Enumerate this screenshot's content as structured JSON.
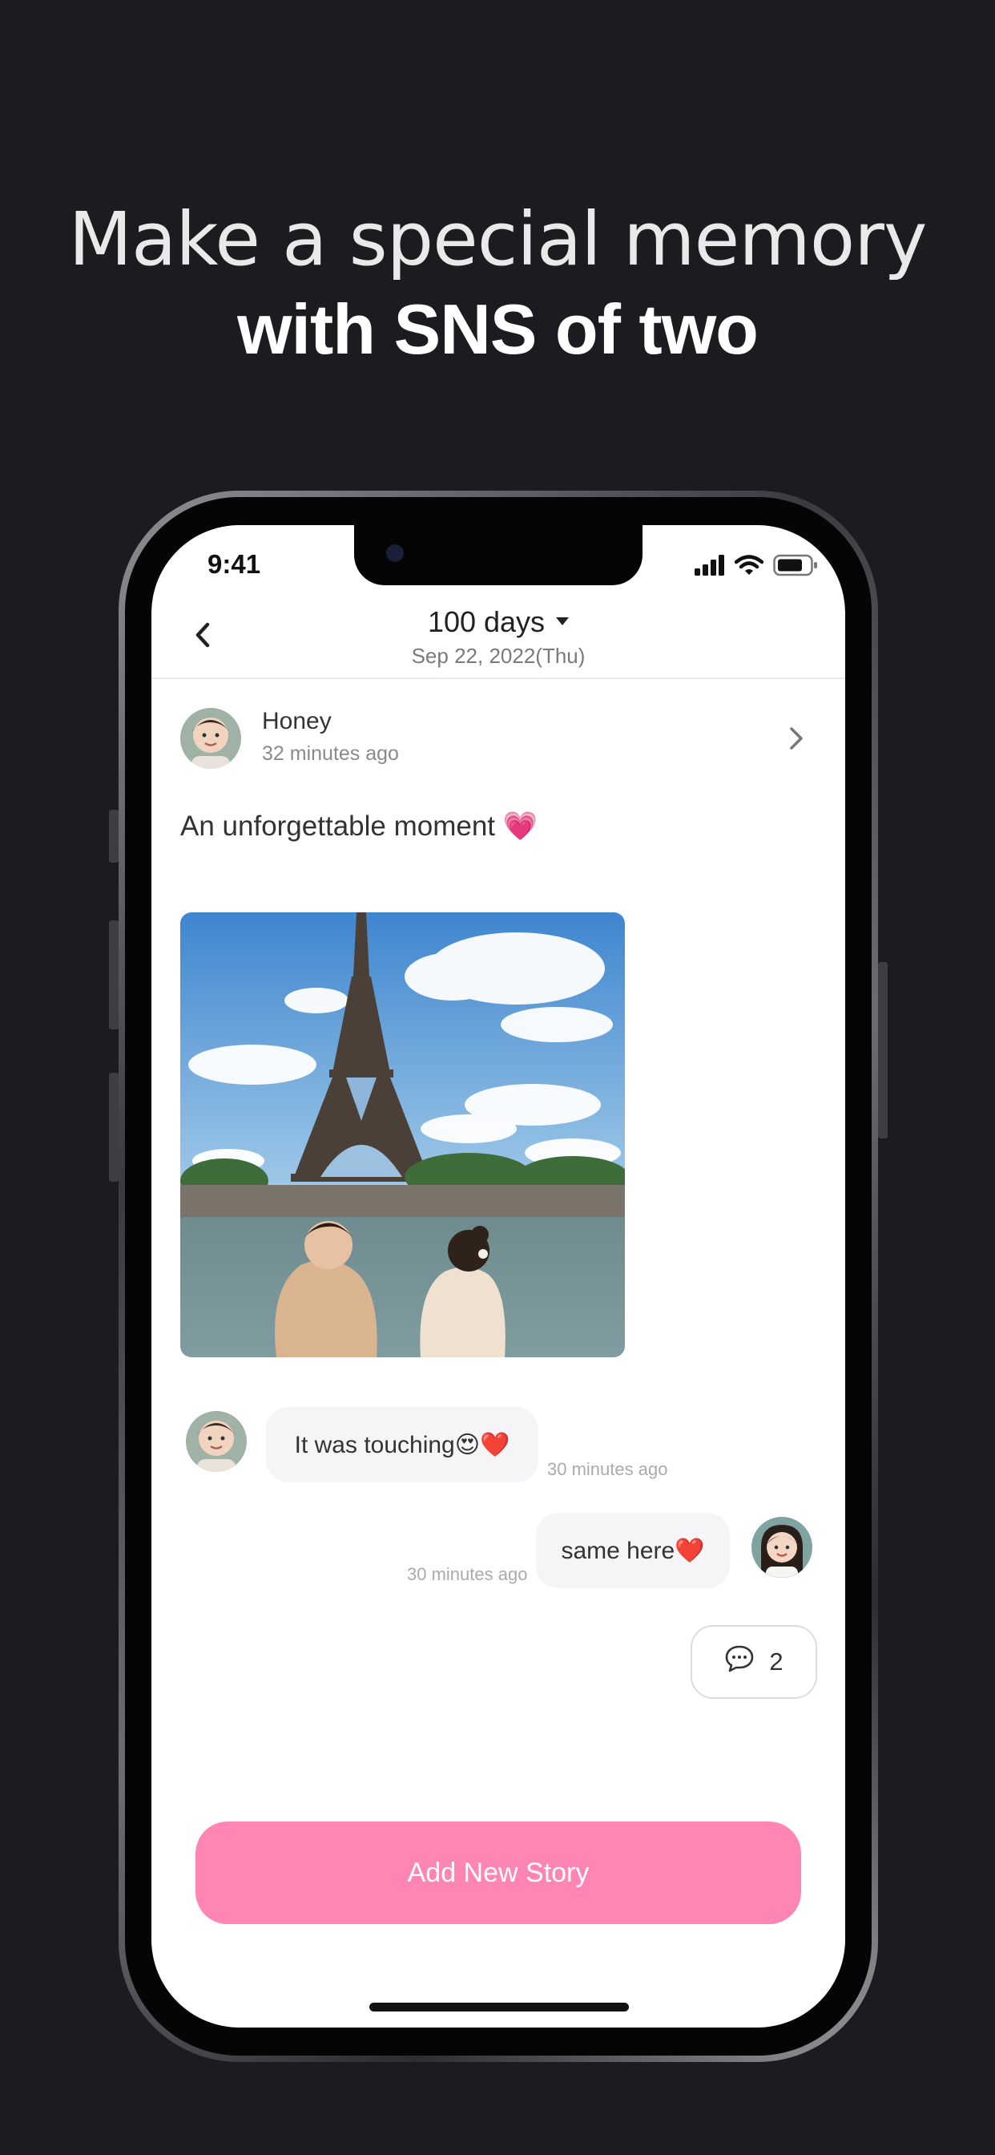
{
  "headline": {
    "line1": "Make a special memory",
    "line2": "with SNS of two"
  },
  "status_bar": {
    "time": "9:41",
    "icons": [
      "signal-icon",
      "wifi-icon",
      "battery-icon"
    ]
  },
  "header": {
    "title": "100 days",
    "date": "Sep 22, 2022(Thu)"
  },
  "post": {
    "author": "Honey",
    "time": "32 minutes ago",
    "text": "An unforgettable moment 💗"
  },
  "comments": [
    {
      "text": "It was touching😍❤️",
      "time": "30 minutes ago",
      "side": "left"
    },
    {
      "text": "same here❤️",
      "time": "30 minutes ago",
      "side": "right"
    }
  ],
  "comment_count": "2",
  "cta_label": "Add New Story",
  "colors": {
    "background": "#1b1c20",
    "accent": "#ff85b4",
    "bubble": "#f5f5f7"
  }
}
